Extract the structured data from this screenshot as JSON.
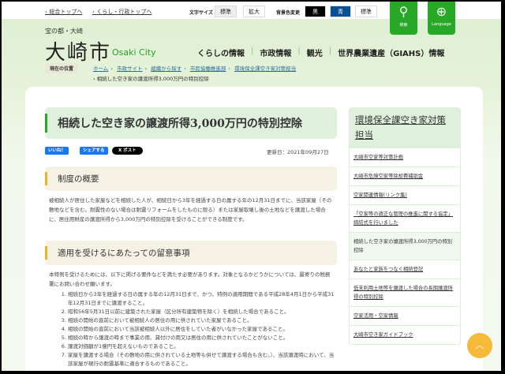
{
  "topbar": {
    "link1": "総合トップへ",
    "link2": "くらし・行政トップへ",
    "fontsize_label": "文字サイズ",
    "fs_standard": "標準",
    "fs_large": "拡大",
    "bg_label": "背景色変更",
    "bg_black": "黒",
    "bg_blue": "青",
    "bg_standard": "標準",
    "search": "検索",
    "language": "Language"
  },
  "header": {
    "tagline": "宝の都・大崎",
    "logo": "大崎市",
    "logo_en": "Osaki City",
    "nav": [
      "くらしの情報",
      "市政情報",
      "観光",
      "世界農業遺産（GIAHS）情報"
    ]
  },
  "breadcrumb": {
    "label": "現在の位置",
    "items": [
      "ホーム",
      "市政サイト",
      "組織から探す",
      "市民協働推進部",
      "環境保全課空き家対策担当"
    ],
    "current": "相続した空き家の譲渡所得3,000万円の特別控除"
  },
  "main": {
    "title": "相続した空き家の譲渡所得3,000万円の特別控除",
    "social": {
      "like": "いいね！",
      "share": "シェアする",
      "post": "X ポスト"
    },
    "updated": "更新日：2021年09月27日",
    "sections": [
      {
        "heading": "制度の概要",
        "text": "被相続人が居住した家屋などを相続した人が、相続日から3年を経過する日の属する年の12月31日までに、当該家屋（その敷地などを含む。耐震性のない場合は耐震リフォームをしたものに限る）または家屋取壊し後の土地などを譲渡した場合に、居住用財産の譲渡所得から3,000万円の特別控除を受けることができる制度です。"
      },
      {
        "heading": "適用を受けるにあたっての留意事項",
        "text": "本特例を受けるためには、以下に掲げる要件などを満たす必要があります。対象となるかどうかについては、最寄りの税務署にお問い合わせ願います。"
      }
    ],
    "requirements": [
      "相続日から3年を経過する日の属する年の12月31日まで、かつ、特例の適用期間である平成28年4月1日から平成31年12月31日までに譲渡すること。",
      "昭和56年5月31日以前に建築された家屋（区分所有建築物を除く）を相続した場合であること。",
      "相続の開始の直前において被相続人の居住の用に供されていた家屋であること。",
      "相続の開始の直前において当該被相続人以外に居住をしていた者がいなかった家屋であること。",
      "相続の時から譲渡の時まで事業の用、貸付けの用又は居住の用に供されていたことがないこと。",
      "譲渡対価額が1億円を超えないものであること。",
      "家屋を譲渡する場合（その敷地の用に供されている土地等も併せて譲渡する場合も含む。）、当該譲渡時において、当該家屋が現行の耐震基準に適合するものであること。"
    ]
  },
  "sidebar": {
    "heading": "環境保全課空き家対策担当",
    "items": [
      "大崎市空家等対策計画",
      "大崎市危険空家等除却費補助金",
      "空家関連情報(リンク集)",
      "「空家等の適正な管理の推進に関する協定」締結式を行いました",
      "相続した空き家の譲渡所得3,000万円の特別控除",
      "あなたと家族をつなぐ相続登記",
      "低未利用土地等を譲渡した場合の長期譲渡所得の特別控除",
      "空家活用・空家情報",
      "大崎市空き家ガイドブック"
    ],
    "current_index": 4
  },
  "colors": {
    "brand_green": "#27a827",
    "accent_orange": "#f0b030"
  }
}
